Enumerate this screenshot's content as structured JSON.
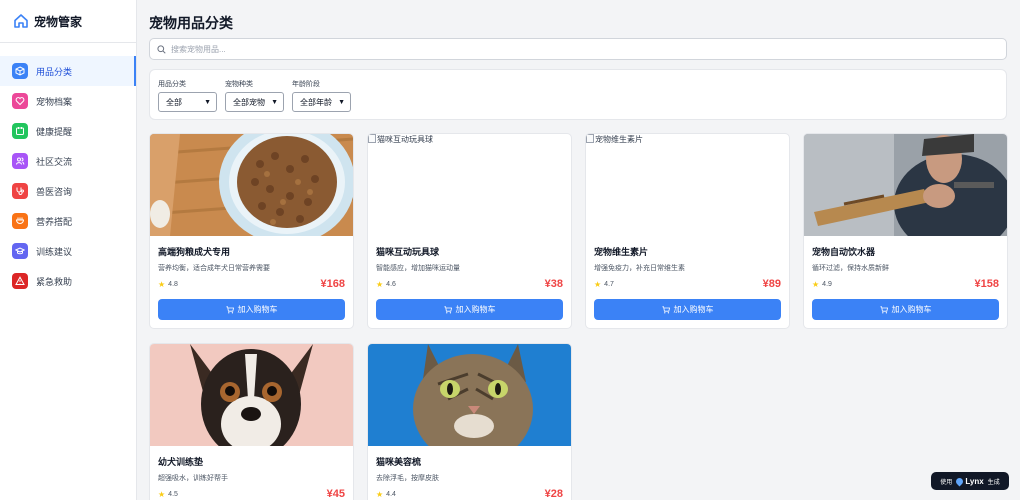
{
  "app": {
    "name": "宠物管家"
  },
  "sidebar": {
    "items": [
      {
        "label": "用品分类",
        "icon": "cube-icon",
        "color": "#3b82f6",
        "active": true
      },
      {
        "label": "宠物档案",
        "icon": "heart-icon",
        "color": "#ec4899",
        "active": false
      },
      {
        "label": "健康提醒",
        "icon": "calendar-icon",
        "color": "#22c55e",
        "active": false
      },
      {
        "label": "社区交流",
        "icon": "users-icon",
        "color": "#a855f7",
        "active": false
      },
      {
        "label": "兽医咨询",
        "icon": "stethoscope-icon",
        "color": "#ef4444",
        "active": false
      },
      {
        "label": "营养搭配",
        "icon": "bowl-icon",
        "color": "#f97316",
        "active": false
      },
      {
        "label": "训练建议",
        "icon": "graduation-cap-icon",
        "color": "#6366f1",
        "active": false
      },
      {
        "label": "紧急救助",
        "icon": "warning-icon",
        "color": "#dc2626",
        "active": false
      }
    ]
  },
  "main": {
    "title": "宠物用品分类",
    "search_placeholder": "搜索宠物用品...",
    "filters": [
      {
        "label": "用品分类",
        "value": "全部"
      },
      {
        "label": "宠物种类",
        "value": "全部宠物"
      },
      {
        "label": "年龄阶段",
        "value": "全部年龄"
      }
    ],
    "cart_label": "加入购物车",
    "products": [
      {
        "name": "高端狗粮成犬专用",
        "desc": "营养均衡，适合成年犬日常营养需要",
        "rating": "4.8",
        "price": "¥168",
        "image": "dog-food-photo",
        "alt": ""
      },
      {
        "name": "猫咪互动玩具球",
        "desc": "智能感应，增加猫咪运动量",
        "rating": "4.6",
        "price": "¥38",
        "image": "broken-image",
        "alt": "猫咪互动玩具球"
      },
      {
        "name": "宠物维生素片",
        "desc": "增强免疫力，补充日常维生素",
        "rating": "4.7",
        "price": "¥89",
        "image": "broken-image",
        "alt": "宠物维生素片"
      },
      {
        "name": "宠物自动饮水器",
        "desc": "循环过滤，保持水质新鲜",
        "rating": "4.9",
        "price": "¥158",
        "image": "water-device-photo",
        "alt": ""
      },
      {
        "name": "幼犬训练垫",
        "desc": "超强吸水，训练好帮手",
        "rating": "4.5",
        "price": "¥45",
        "image": "puppy-photo",
        "alt": ""
      },
      {
        "name": "猫咪美容梳",
        "desc": "去除浮毛，按摩皮肤",
        "rating": "4.4",
        "price": "¥28",
        "image": "cat-photo",
        "alt": ""
      }
    ]
  },
  "badge": {
    "prefix": "使用",
    "brand": "Lynx",
    "suffix": "生成"
  }
}
